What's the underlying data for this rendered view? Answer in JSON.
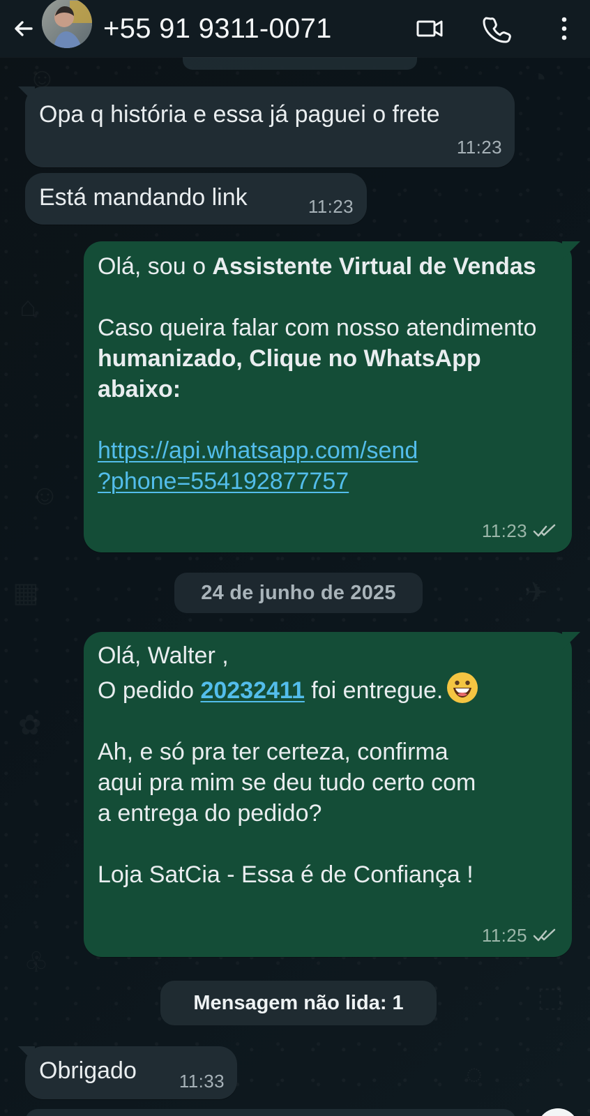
{
  "header": {
    "contact_phone": "+55 91 9311-0071",
    "icons": {
      "back": "back-arrow-icon",
      "video": "video-call-icon",
      "call": "phone-call-icon",
      "menu": "more-options-icon"
    }
  },
  "messages": {
    "m1": {
      "text": "Opa q história e essa já paguei o frete",
      "time": "11:23"
    },
    "m2": {
      "text": "Está mandando link",
      "time": "11:23"
    },
    "m3": {
      "intro": "Olá, sou o ",
      "intro_bold": "Assistente Virtual de Vendas",
      "para2_start": "Caso queira falar com nosso atendimento ",
      "para2_bold": "humanizado, Clique no WhatsApp abaixo:",
      "link_line1": "https://api.whatsapp.com/send",
      "link_line2": "?phone=554192877757",
      "time": "11:23"
    },
    "date_separator": "24 de junho de 2025",
    "m4": {
      "line1": "Olá, Walter ,",
      "line2_start": "O pedido ",
      "order_number": "20232411",
      "line2_end": " foi entregue.",
      "line3": "Ah, e só pra ter certeza, confirma",
      "line4": "aqui pra mim se deu tudo certo com",
      "line5": "a entrega do pedido?",
      "line6": "Loja SatCia - Essa é de Confiança !",
      "time": "11:25"
    },
    "unread_label": "Mensagem não lida: 1",
    "m5": {
      "text": "Obrigado",
      "time": "11:33"
    }
  },
  "colors": {
    "header": "#111b21",
    "incoming_bubble": "#202c33",
    "outgoing_bubble": "#144d37",
    "link": "#53bdeb"
  }
}
